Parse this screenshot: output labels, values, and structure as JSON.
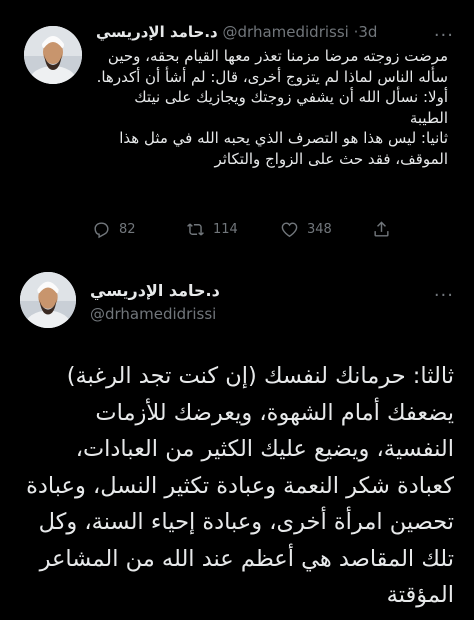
{
  "tweet1": {
    "author_name": "د.حامد الإدريسي",
    "handle": "@drhamedidrissi",
    "separator": "·",
    "time": "3d",
    "more_label": "···",
    "paragraphs": [
      "مرضت زوجته مرضا مزمنا تعذر معها القيام بحقه، وحين سأله الناس لماذا لم يتزوج أخرى، قال: لم أشأ أن أكدرها.",
      "أولا: نسأل الله أن يشفي زوجتك ويجازيك على نيتك الطيبة",
      "ثانيا: ليس هذا هو التصرف الذي يحبه الله في مثل هذا الموقف، فقد حث على الزواج والتكاثر"
    ],
    "actions": {
      "reply_count": "82",
      "retweet_count": "114",
      "like_count": "348"
    }
  },
  "tweet2": {
    "author_name": "د.حامد الإدريسي",
    "handle": "@drhamedidrissi",
    "more_label": "···",
    "body": "ثالثا: حرمانك لنفسك (إن كنت تجد الرغبة) يضعفك أمام الشهوة، ويعرضك للأزمات النفسية، ويضيع عليك الكثير من العبادات، كعبادة شكر النعمة وعبادة تكثير النسل، وعبادة تحصين امرأة أخرى، وعبادة إحياء السنة، وكل تلك المقاصد هي أعظم عند الله من المشاعر المؤقتة"
  },
  "colors": {
    "background": "#000000",
    "text": "#e7e9ea",
    "secondary": "#71767b"
  },
  "icons": [
    "reply-icon",
    "retweet-icon",
    "like-icon",
    "share-icon",
    "more-icon"
  ]
}
